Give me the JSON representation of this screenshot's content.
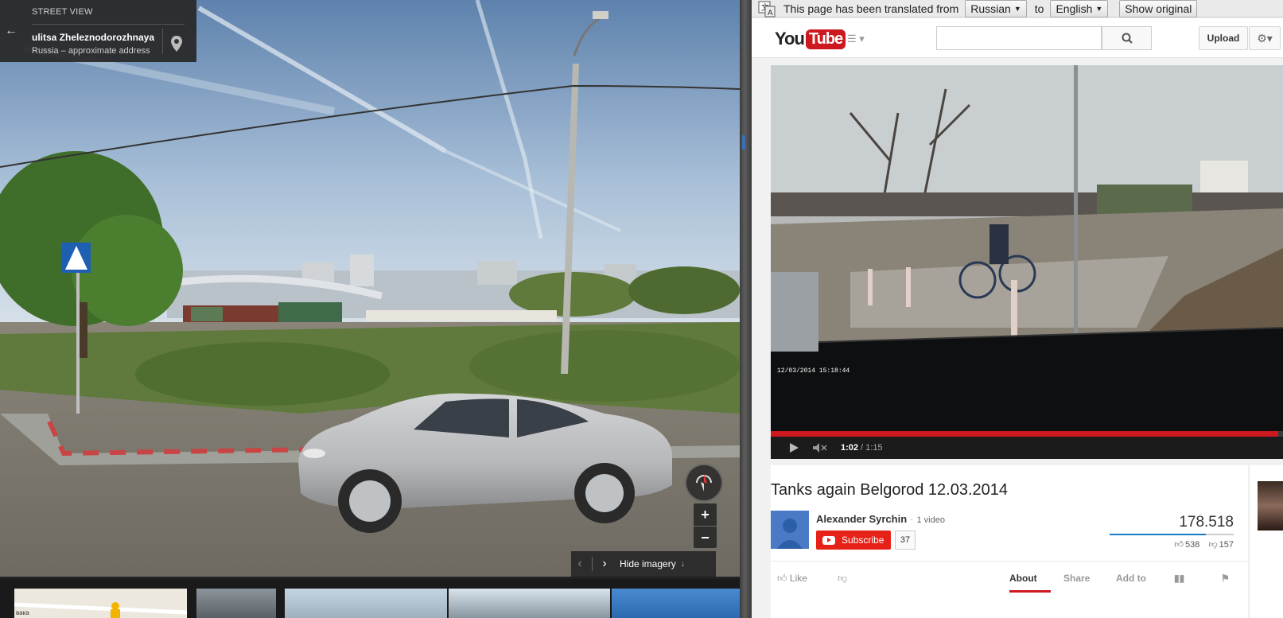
{
  "street_view": {
    "header_label": "STREET VIEW",
    "street_name": "ulitsa Zheleznodorozhnaya",
    "address_note": "Russia – approximate address",
    "zoom_in": "+",
    "zoom_out": "−",
    "imagery_toggle": "Hide imagery",
    "thumbnail_map_label": "вака"
  },
  "translate_bar": {
    "message": "This page has been translated from",
    "source_language": "Russian",
    "to_label": "to",
    "target_language": "English",
    "show_original": "Show original"
  },
  "youtube": {
    "logo_you": "You",
    "logo_tube": "Tube",
    "search_placeholder": "",
    "upload_label": "Upload",
    "player": {
      "timestamp_overlay": "12/03/2014 15:18:44",
      "current_time": "1:02",
      "duration": "/ 1:15",
      "progress_fraction": 0.99
    },
    "video_title": "Tanks again Belgorod 12.03.2014",
    "channel_name": "Alexander Syrchin",
    "channel_separator": "·",
    "channel_video_count": "1 video",
    "subscribe_label": "Subscribe",
    "subscriber_count": "37",
    "view_count": "178.518",
    "like_count": "538",
    "dislike_count": "157",
    "like_ratio": 0.774,
    "like_button": "Like",
    "tabs": [
      "About",
      "Share",
      "Add to"
    ]
  },
  "colors": {
    "youtube_red": "#cc181e",
    "subscribe_red": "#e62117",
    "sentiment_blue": "#167ac6"
  }
}
